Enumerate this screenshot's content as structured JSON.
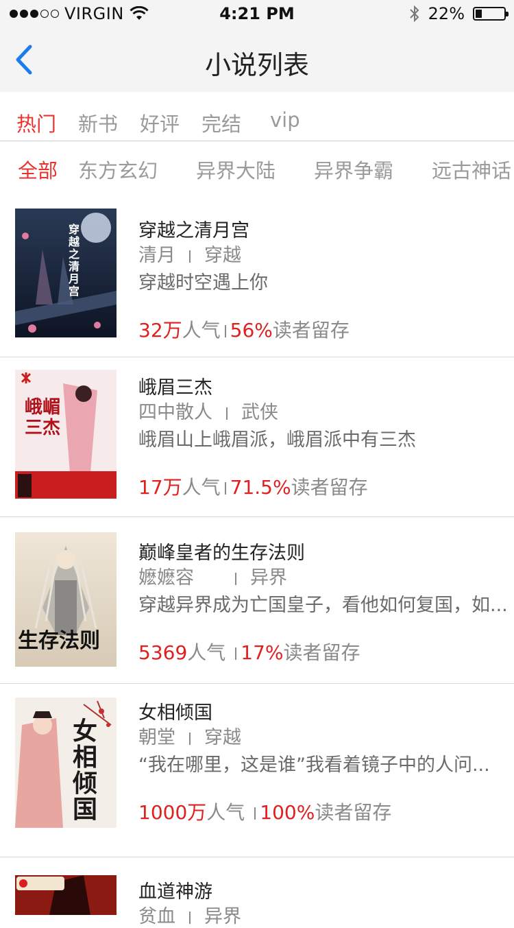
{
  "status_bar": {
    "carrier": "VIRGIN",
    "time": "4:21 PM",
    "battery_text": "22%",
    "battery_level": 0.22
  },
  "nav": {
    "title": "小说列表"
  },
  "tabs": [
    {
      "label": "热门",
      "active": true
    },
    {
      "label": "新书",
      "active": false
    },
    {
      "label": "好评",
      "active": false
    },
    {
      "label": "完结",
      "active": false
    },
    {
      "label": "vip",
      "active": false
    }
  ],
  "categories": [
    {
      "label": "全部",
      "active": true
    },
    {
      "label": "东方玄幻",
      "active": false
    },
    {
      "label": "异界大陆",
      "active": false
    },
    {
      "label": "异界争霸",
      "active": false
    },
    {
      "label": "远古神话",
      "active": false
    }
  ],
  "novels": [
    {
      "title": "穿越之清月宫",
      "author": "清月",
      "genre": "穿越",
      "description": "穿越时空遇上你",
      "popularity": "32万",
      "popularity_label": "人气",
      "retention": "56%",
      "retention_label": "读者留存",
      "cover_text": "穿越之清月宫"
    },
    {
      "title": "峨眉三杰",
      "author": "四中散人",
      "genre": "武侠",
      "description": "峨眉山上峨眉派，峨眉派中有三杰",
      "popularity": "17万",
      "popularity_label": "人气",
      "retention": "71.5%",
      "retention_label": "读者留存",
      "cover_text": "峨嵋三杰"
    },
    {
      "title": "巅峰皇者的生存法则",
      "author": "嬷嬷容",
      "genre": "异界",
      "description": "穿越异界成为亡国皇子，看他如何复国，如...",
      "popularity": "5369",
      "popularity_label": "人气",
      "retention": "17%",
      "retention_label": "读者留存",
      "cover_text": "生存法则"
    },
    {
      "title": "女相倾国",
      "author": "朝堂",
      "genre": "穿越",
      "description": "“我在哪里，这是谁”我看着镜子中的人问...",
      "popularity": "1000万",
      "popularity_label": "人气",
      "retention": "100%",
      "retention_label": "读者留存",
      "cover_text": "女相倾国"
    },
    {
      "title": "血道神游",
      "author": "贫血",
      "genre": "异界",
      "description": "",
      "popularity": "",
      "popularity_label": "",
      "retention": "",
      "retention_label": "",
      "cover_text": ""
    }
  ],
  "colors": {
    "accent": "#e8322e",
    "stat_red": "#e01f1f",
    "back_blue": "#1a7cf0",
    "inactive": "#9a9a9a"
  }
}
